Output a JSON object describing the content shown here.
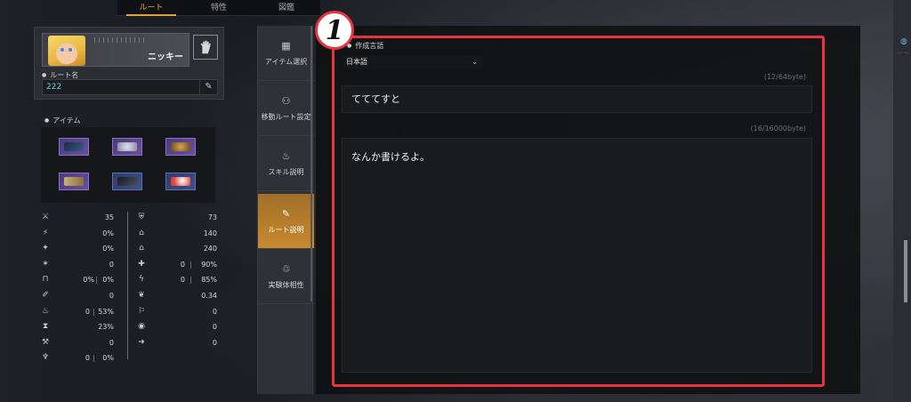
{
  "top_tabs": [
    {
      "label": "ルート",
      "active": true
    },
    {
      "label": "特性",
      "active": false
    },
    {
      "label": "図鑑",
      "active": false
    }
  ],
  "character": {
    "name": "ニッキー",
    "route_label": "ルート名",
    "route_name": "222"
  },
  "items": {
    "label": "アイテム",
    "slots": [
      {
        "icon": "weapon-icon",
        "tier": "purple"
      },
      {
        "icon": "head-armor-icon",
        "tier": "purple"
      },
      {
        "icon": "chest-armor-icon",
        "tier": "purple"
      },
      {
        "icon": "arm-armor-icon",
        "tier": "purple"
      },
      {
        "icon": "leg-armor-icon",
        "tier": "blue"
      },
      {
        "icon": "accessory-icon",
        "tier": "blue"
      }
    ]
  },
  "stats": {
    "left": [
      {
        "icon": "attack-power-icon",
        "value": "35"
      },
      {
        "icon": "attack-speed-icon",
        "value": "0%"
      },
      {
        "icon": "critical-icon",
        "value": "0%"
      },
      {
        "icon": "skill-amp-icon",
        "value": "0"
      },
      {
        "icon": "armor-pen-icon",
        "value": "0%",
        "secondary": "0%"
      },
      {
        "icon": "cooldown-icon",
        "value": "0"
      },
      {
        "icon": "lifesteal-icon",
        "value": "0",
        "secondary": "53%"
      },
      {
        "icon": "hourglass-icon",
        "value": "23%"
      },
      {
        "icon": "defense-break-icon",
        "value": "0"
      },
      {
        "icon": "omnivamp-icon",
        "value": "0",
        "secondary": "0%"
      }
    ],
    "right": [
      {
        "icon": "defense-icon",
        "value": "73"
      },
      {
        "icon": "max-hp-icon",
        "value": "140"
      },
      {
        "icon": "max-sp-icon",
        "value": "240"
      },
      {
        "icon": "hp-regen-icon",
        "value": "0",
        "secondary": "90%"
      },
      {
        "icon": "sp-regen-icon",
        "value": "0",
        "secondary": "85%"
      },
      {
        "icon": "tenacity-icon",
        "value": "0.34"
      },
      {
        "icon": "reduction-icon",
        "value": "0"
      },
      {
        "icon": "vision-icon",
        "value": "0"
      },
      {
        "icon": "move-speed-icon",
        "value": "0"
      }
    ]
  },
  "nav": [
    {
      "label": "アイテム選択",
      "icon": "items-icon",
      "active": false
    },
    {
      "label": "移動ルート設定",
      "icon": "route-icon",
      "active": false
    },
    {
      "label": "スキル説明",
      "icon": "skill-icon",
      "active": false
    },
    {
      "label": "ルート説明",
      "icon": "pencil-icon",
      "active": true
    },
    {
      "label": "実験体相性",
      "icon": "synergy-icon",
      "active": false
    }
  ],
  "editor": {
    "badge": "1",
    "lang_label": "作成言語",
    "lang_value": "日本語",
    "title_counter": "(12/64byte)",
    "title_value": "てててすと",
    "body_counter": "(16/16000byte)",
    "body_value": "なんか書けるよ。"
  },
  "colors": {
    "accent": "#e3a23a",
    "highlight": "#e8343f",
    "route_name": "#5fd6e0"
  }
}
